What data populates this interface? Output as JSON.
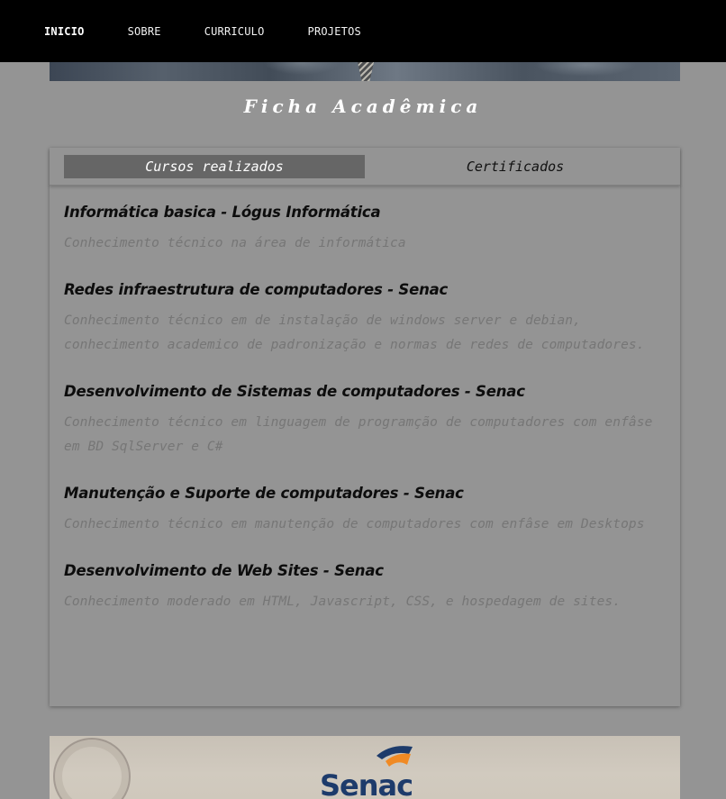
{
  "nav": {
    "items": [
      {
        "label": "INICIO",
        "active": true
      },
      {
        "label": "SOBRE",
        "active": false
      },
      {
        "label": "CURRICULO",
        "active": false
      },
      {
        "label": "PROJETOS",
        "active": false
      }
    ]
  },
  "section": {
    "title": "Ficha Acadêmica"
  },
  "tabs": [
    {
      "label": "Cursos realizados",
      "active": true
    },
    {
      "label": "Certificados",
      "active": false
    }
  ],
  "courses": [
    {
      "title": "Informática basica - Lógus Informática",
      "description": "Conhecimento técnico na área de informática"
    },
    {
      "title": "Redes infraestrutura de computadores - Senac",
      "description": "Conhecimento técnico em de instalação de windows server e debian, conhecimento academico de padronização e normas de redes de computadores."
    },
    {
      "title": "Desenvolvimento de Sistemas de computadores - Senac",
      "description": "Conhecimento técnico em linguagem de programção de computadores com enfâse em BD SqlServer e C#"
    },
    {
      "title": "Manutenção e Suporte de computadores - Senac",
      "description": "Conhecimento técnico em manutenção de computadores com enfâse em Desktops"
    },
    {
      "title": "Desenvolvimento de Web Sites - Senac",
      "description": "Conhecimento moderado em HTML, Javascript, CSS, e hospedagem de sites."
    }
  ],
  "certificate_preview": {
    "brand_text": "Senac"
  },
  "colors": {
    "navbar": "#000000",
    "page_background": "#949494",
    "active_tab": "#666666",
    "description_text": "#767676",
    "senac_blue": "#1d3b6b",
    "senac_orange": "#f08a24"
  }
}
